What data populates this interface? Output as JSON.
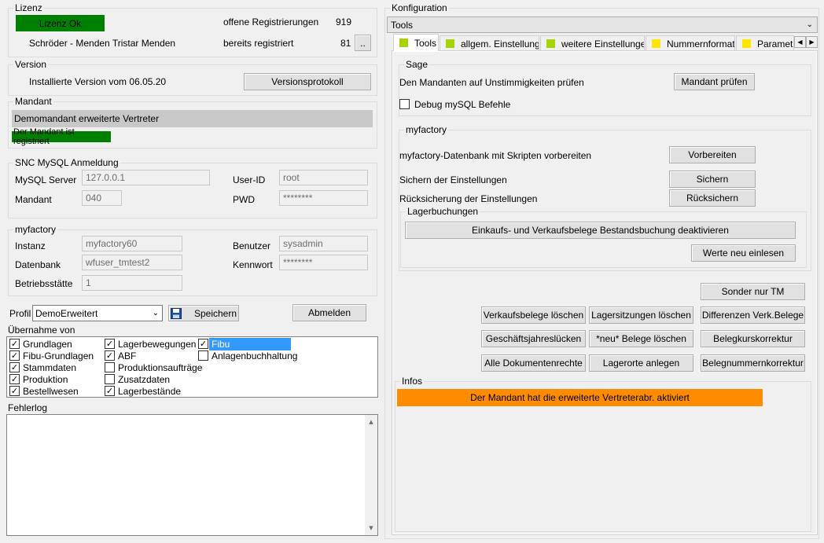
{
  "lizenz": {
    "title": "Lizenz",
    "status": "Lizenz Ok",
    "company": "Schröder - Menden Tristar Menden",
    "open_label": "offene Registrierungen",
    "open_value": "919",
    "registered_label": "bereits registriert",
    "registered_value": "81",
    "more_button": "..",
    "status_color": "#008000"
  },
  "version": {
    "title": "Version",
    "installed": "Installierte Version vom 06.05.20",
    "button": "Versionsprotokoll"
  },
  "mandant": {
    "title": "Mandant",
    "name": "Demomandant erweiterte Vertreter",
    "status": "Der Mandant ist registriert"
  },
  "snc": {
    "title": "SNC MySQL Anmeldung",
    "server_label": "MySQL Server",
    "server_value": "127.0.0.1",
    "userid_label": "User-ID",
    "userid_value": "root",
    "mandant_label": "Mandant",
    "mandant_value": "040",
    "pwd_label": "PWD",
    "pwd_value": "********"
  },
  "myfactory_login": {
    "title": "myfactory",
    "instanz_label": "Instanz",
    "instanz_value": "myfactory60",
    "benutzer_label": "Benutzer",
    "benutzer_value": "sysadmin",
    "datenbank_label": "Datenbank",
    "datenbank_value": "wfuser_tmtest2",
    "kennwort_label": "Kennwort",
    "kennwort_value": "********",
    "betrieb_label": "Betriebsstätte",
    "betrieb_value": "1"
  },
  "profil": {
    "label": "Profil",
    "selected": "DemoErweitert",
    "save_button": "Speichern",
    "logout_button": "Abmelden"
  },
  "uebernahme": {
    "title": "Übernahme von",
    "items": [
      {
        "label": "Grundlagen",
        "checked": true
      },
      {
        "label": "Fibu-Grundlagen",
        "checked": true
      },
      {
        "label": "Stammdaten",
        "checked": true
      },
      {
        "label": "Produktion",
        "checked": true
      },
      {
        "label": "Bestellwesen",
        "checked": true
      },
      {
        "label": "Lagerbewegungen",
        "checked": true
      },
      {
        "label": "ABF",
        "checked": true
      },
      {
        "label": "Produktionsaufträge",
        "checked": false
      },
      {
        "label": "Zusatzdaten",
        "checked": false
      },
      {
        "label": "Lagerbestände",
        "checked": true
      },
      {
        "label": "Fibu",
        "checked": true
      },
      {
        "label": "Anlagenbuchhaltung",
        "checked": false
      }
    ]
  },
  "fehlerlog": {
    "title": "Fehlerlog",
    "content": ""
  },
  "konfiguration": {
    "title": "Konfiguration",
    "dropdown": "Tools",
    "tabs": [
      {
        "label": "Tools",
        "color": "#a5d400"
      },
      {
        "label": "allgem. Einstellungen",
        "color": "#a5d400"
      },
      {
        "label": "weitere Einstellungen",
        "color": "#a5d400"
      },
      {
        "label": "Nummernformate",
        "color": "#ffe600"
      },
      {
        "label": "Paramete",
        "color": "#ffe600"
      }
    ]
  },
  "sage": {
    "title": "Sage",
    "check_label": "Den Mandanten auf Unstimmigkeiten prüfen",
    "check_button": "Mandant prüfen",
    "debug_label": "Debug mySQL Befehle",
    "debug_checked": false
  },
  "myfactory_tools": {
    "title": "myfactory",
    "prepare_label": "myfactory-Datenbank mit Skripten vorbereiten",
    "prepare_button": "Vorbereiten",
    "save_label": "Sichern der Einstellungen",
    "save_button": "Sichern",
    "restore_label": "Rücksicherung der Einstellungen",
    "restore_button": "Rücksichern"
  },
  "lagerbuchungen": {
    "title": "Lagerbuchungen",
    "deactivate_button": "Einkaufs- und Verkaufsbelege Bestandsbuchung deaktivieren",
    "reload_button": "Werte neu einlesen"
  },
  "actions": {
    "sonder": "Sonder nur TM",
    "verkaufsbelege": "Verkaufsbelege löschen",
    "lagersitzungen": "Lagersitzungen löschen",
    "differenzen": "Differenzen Verk.Belege",
    "geschaeftsjahr": "Geschäftsjahreslücken",
    "neu_belege": "*neu* Belege löschen",
    "belegkurs": "Belegkurskorrektur",
    "dokumentenrechte": "Alle Dokumentenrechte",
    "lagerorte": "Lagerorte anlegen",
    "belegnummern": "Belegnummernkorrektur"
  },
  "infos": {
    "title": "Infos",
    "message": "Der Mandant hat die erweiterte Vertreterabr. aktiviert",
    "message_color": "#ff8c00"
  }
}
